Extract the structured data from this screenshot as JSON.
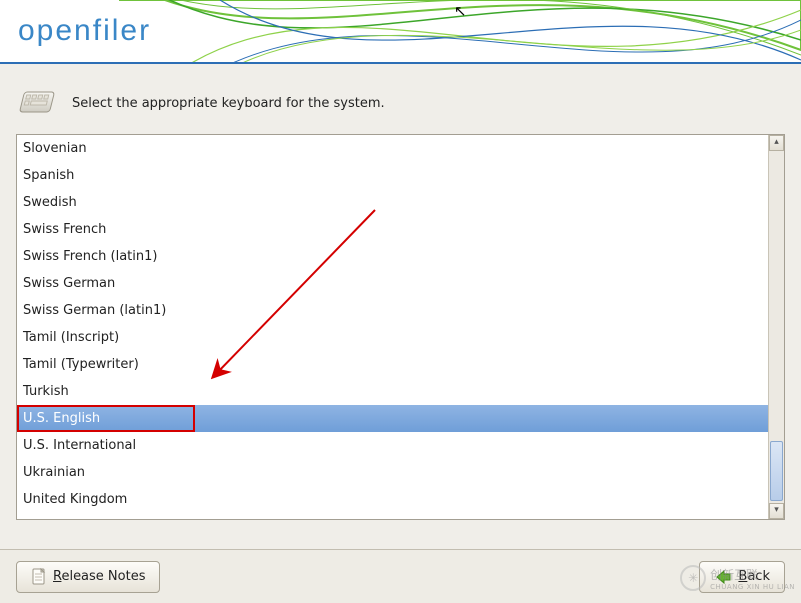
{
  "brand": "openfiler",
  "prompt": "Select the appropriate keyboard for the system.",
  "keyboard_layouts": [
    {
      "label": "Slovenian",
      "selected": false
    },
    {
      "label": "Spanish",
      "selected": false
    },
    {
      "label": "Swedish",
      "selected": false
    },
    {
      "label": "Swiss French",
      "selected": false
    },
    {
      "label": "Swiss French (latin1)",
      "selected": false
    },
    {
      "label": "Swiss German",
      "selected": false
    },
    {
      "label": "Swiss German (latin1)",
      "selected": false
    },
    {
      "label": "Tamil (Inscript)",
      "selected": false
    },
    {
      "label": "Tamil (Typewriter)",
      "selected": false
    },
    {
      "label": "Turkish",
      "selected": false
    },
    {
      "label": "U.S. English",
      "selected": true
    },
    {
      "label": "U.S. International",
      "selected": false
    },
    {
      "label": "Ukrainian",
      "selected": false
    },
    {
      "label": "United Kingdom",
      "selected": false
    }
  ],
  "buttons": {
    "release_notes": "Release Notes",
    "back": "Back"
  },
  "watermark": {
    "line1": "创新互联",
    "line2": "CHUANG XIN HU LIAN"
  },
  "colors": {
    "selection": "#7ca6dd",
    "highlight_border": "#d40000",
    "header_rule": "#2c6eb5",
    "logo": "#3a87c7"
  },
  "annotation": {
    "arrow_target": "U.S. English"
  }
}
